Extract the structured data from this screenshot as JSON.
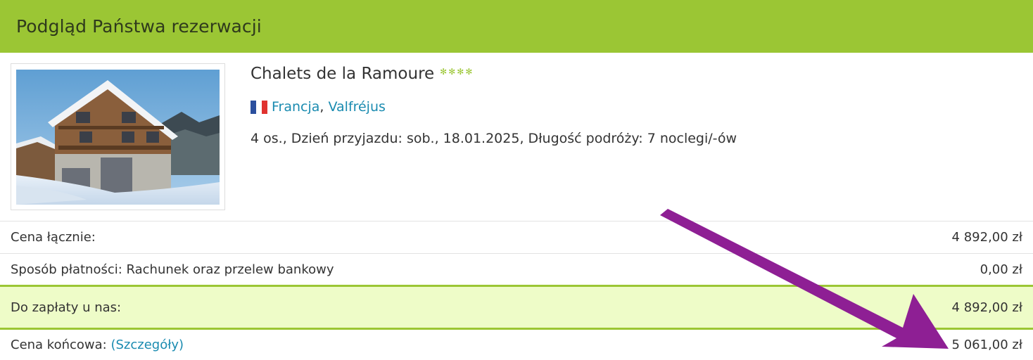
{
  "header": {
    "title": "Podgląd Państwa rezerwacji"
  },
  "hotel": {
    "name": "Chalets de la Ramoure",
    "star_icon": "✻",
    "star_count": 4,
    "country": "Francja",
    "separator": ",",
    "region": "Valfréjus",
    "trip_info": "4 os., Dzień przyjazdu: sob., 18.01.2025, Długość podróży: 7 noclegi/-ów"
  },
  "prices": {
    "total_label": "Cena łącznie:",
    "total_value": "4 892,00 zł",
    "payment_label": "Sposób płatności: Rachunek oraz przelew bankowy",
    "payment_value": "0,00 zł",
    "due_label": "Do zapłaty u nas:",
    "due_value": "4 892,00 zł",
    "final_label": "Cena końcowa:",
    "final_details_link": "(Szczegóły)",
    "final_value": "5 061,00 zł"
  },
  "colors": {
    "accent_green": "#9bc634",
    "highlight_row": "#eefcc8",
    "link_blue": "#1a8bb0",
    "annotation_arrow": "#8e1f94"
  },
  "icons": {
    "flag": "france-flag-icon",
    "stars": "star-rating-icon",
    "annotation": "arrow-annotation-icon"
  }
}
